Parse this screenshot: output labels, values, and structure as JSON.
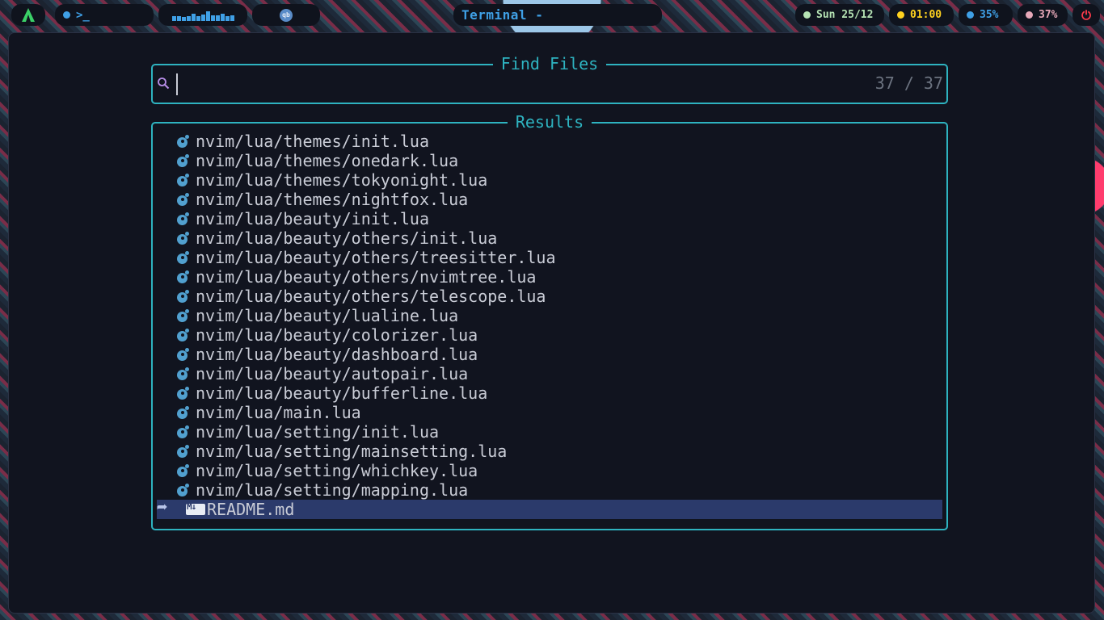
{
  "topbar": {
    "workspace_prompt": ">_",
    "terminal_title": "Terminal -",
    "date": "Sun 25/12",
    "time": "01:00",
    "battery": "35%",
    "memory": "37%",
    "colors": {
      "date_dot": "#b6e3b4",
      "time_dot": "#ffd21f",
      "battery_dot": "#3fa0e6",
      "memory_dot": "#e6a8b8",
      "power": "#ff3b4b"
    },
    "icons": [
      "arch-logo-icon",
      "terminal-icon",
      "sparkline-icon",
      "qbittorrent-icon",
      "power-icon"
    ]
  },
  "finder": {
    "title": "Find Files",
    "query": "",
    "count": "37 / 37",
    "results_title": "Results",
    "files": [
      "nvim/lua/themes/init.lua",
      "nvim/lua/themes/onedark.lua",
      "nvim/lua/themes/tokyonight.lua",
      "nvim/lua/themes/nightfox.lua",
      "nvim/lua/beauty/init.lua",
      "nvim/lua/beauty/others/init.lua",
      "nvim/lua/beauty/others/treesitter.lua",
      "nvim/lua/beauty/others/nvimtree.lua",
      "nvim/lua/beauty/others/telescope.lua",
      "nvim/lua/beauty/lualine.lua",
      "nvim/lua/beauty/colorizer.lua",
      "nvim/lua/beauty/dashboard.lua",
      "nvim/lua/beauty/autopair.lua",
      "nvim/lua/beauty/bufferline.lua",
      "nvim/lua/main.lua",
      "nvim/lua/setting/init.lua",
      "nvim/lua/setting/mainsetting.lua",
      "nvim/lua/setting/whichkey.lua",
      "nvim/lua/setting/mapping.lua"
    ],
    "selected_file": "README.md"
  }
}
